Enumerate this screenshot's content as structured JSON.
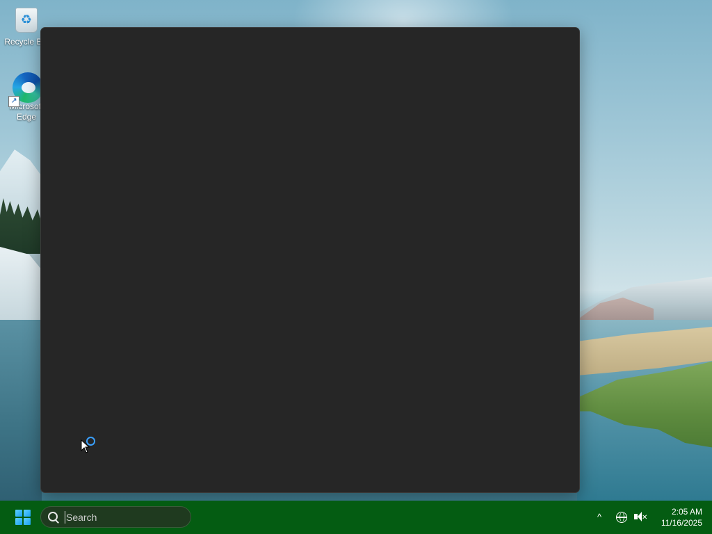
{
  "desktop": {
    "icons": [
      {
        "label": "Recycle Bin",
        "icon": "recycle-bin-icon"
      },
      {
        "label": "Microsoft Edge",
        "icon": "edge-icon"
      }
    ]
  },
  "window": {
    "state": "loading",
    "background": "#262626"
  },
  "taskbar": {
    "color": "#045c12",
    "start_icon": "windows-logo-icon",
    "search": {
      "placeholder": "Search",
      "value": ""
    },
    "tray": {
      "chevron": "^",
      "network_icon": "globe-icon",
      "volume_icon": "speaker-muted-icon"
    },
    "clock": {
      "time": "2:05 AM",
      "date": "11/16/2025"
    }
  }
}
